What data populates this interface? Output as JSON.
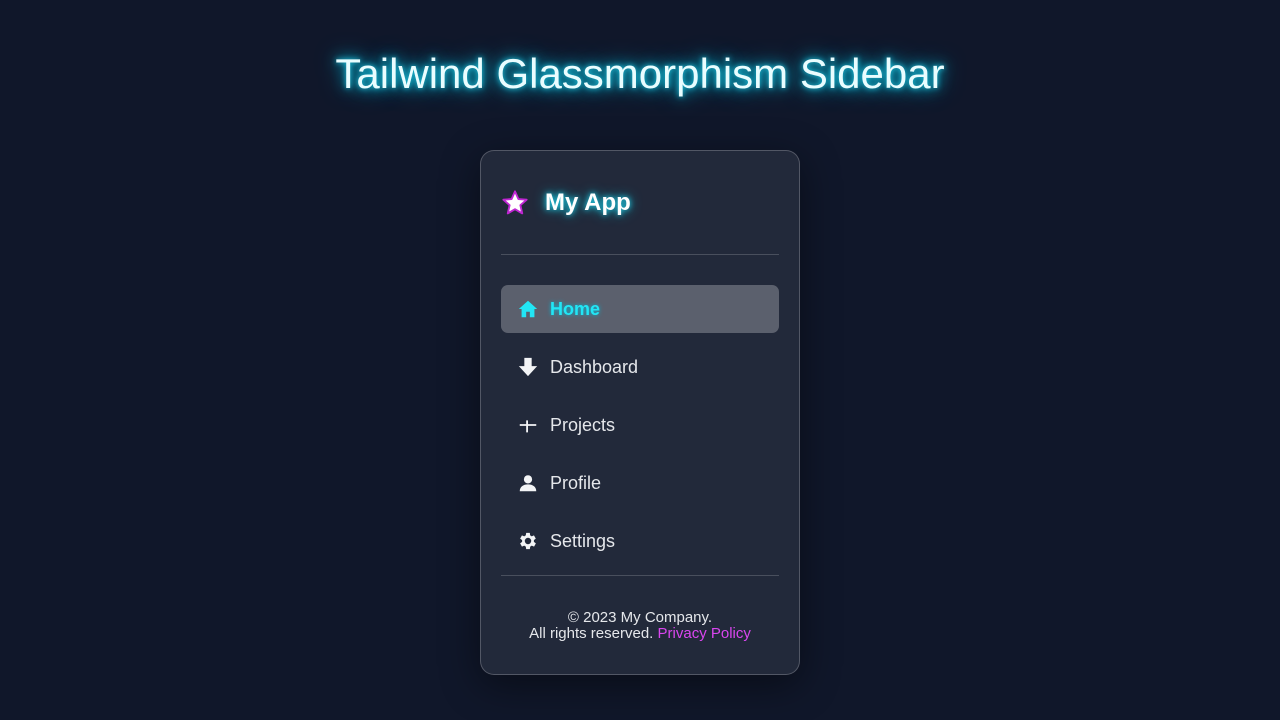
{
  "header": {
    "title": "Tailwind Glassmorphism Sidebar"
  },
  "sidebar": {
    "brand": {
      "name": "My App",
      "icon": "star-icon",
      "icon_color": "#c026d3"
    },
    "items": [
      {
        "label": "Home",
        "icon": "home-icon",
        "active": true
      },
      {
        "label": "Dashboard",
        "icon": "arrow-down-icon",
        "active": false
      },
      {
        "label": "Projects",
        "icon": "plus-icon",
        "active": false
      },
      {
        "label": "Profile",
        "icon": "user-icon",
        "active": false
      },
      {
        "label": "Settings",
        "icon": "gear-icon",
        "active": false
      }
    ],
    "footer": {
      "copyright": "© 2023 My Company.",
      "rights": "All rights reserved.",
      "link_label": "Privacy Policy"
    }
  },
  "colors": {
    "accent": "#22d3ee",
    "link": "#d946ef",
    "background": "#10172a"
  }
}
